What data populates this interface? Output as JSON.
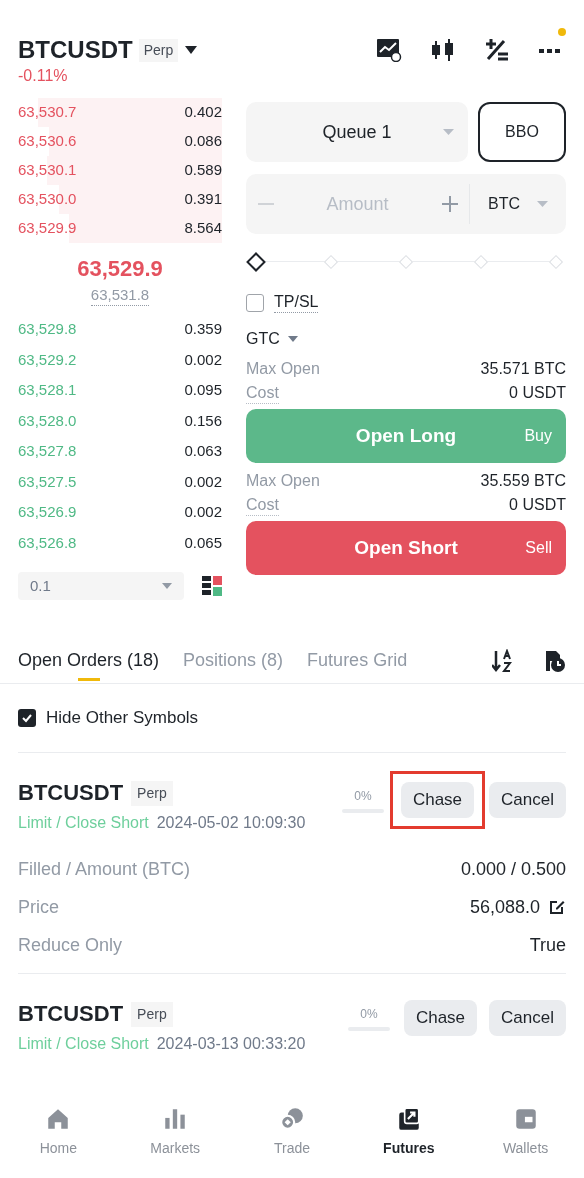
{
  "header": {
    "symbol": "BTCUSDT",
    "badge": "Perp",
    "change": "-0.11%"
  },
  "order_book": {
    "asks": [
      {
        "price": "63,530.7",
        "qty": "0.402"
      },
      {
        "price": "63,530.6",
        "qty": "0.086"
      },
      {
        "price": "63,530.1",
        "qty": "0.589"
      },
      {
        "price": "63,530.0",
        "qty": "0.391"
      },
      {
        "price": "63,529.9",
        "qty": "8.564"
      }
    ],
    "last_price": "63,529.9",
    "mark_price": "63,531.8",
    "bids": [
      {
        "price": "63,529.8",
        "qty": "0.359"
      },
      {
        "price": "63,529.2",
        "qty": "0.002"
      },
      {
        "price": "63,528.1",
        "qty": "0.095"
      },
      {
        "price": "63,528.0",
        "qty": "0.156"
      },
      {
        "price": "63,527.8",
        "qty": "0.063"
      },
      {
        "price": "63,527.5",
        "qty": "0.002"
      },
      {
        "price": "63,526.9",
        "qty": "0.002"
      },
      {
        "price": "63,526.8",
        "qty": "0.065"
      }
    ],
    "precision": "0.1"
  },
  "order_form": {
    "price_type": "Queue 1",
    "bbo": "BBO",
    "amount_placeholder": "Amount",
    "unit": "BTC",
    "slider": {
      "level": 0
    },
    "tpsl": {
      "label": "TP/SL",
      "checked": false
    },
    "tif": "GTC",
    "long": {
      "max_label": "Max Open",
      "max_value": "35.571 BTC",
      "cost_label": "Cost",
      "cost_value": "0 USDT",
      "button": "Open Long",
      "side": "Buy"
    },
    "short": {
      "max_label": "Max Open",
      "max_value": "35.559 BTC",
      "cost_label": "Cost",
      "cost_value": "0 USDT",
      "button": "Open Short",
      "side": "Sell"
    }
  },
  "tabs": [
    {
      "label": "Open Orders (18)",
      "selected": true
    },
    {
      "label": "Positions (8)",
      "selected": false
    },
    {
      "label": "Futures Grid",
      "selected": false
    }
  ],
  "hide_other": {
    "label": "Hide Other Symbols",
    "checked": true
  },
  "orders": [
    {
      "symbol": "BTCUSDT",
      "badge": "Perp",
      "type": "Limit / Close Short",
      "time": "2024-05-02 10:09:30",
      "progress": "0%",
      "level": 0,
      "chase": "Chase",
      "highlighted": true,
      "cancel": "Cancel",
      "details": [
        {
          "label": "Filled / Amount (BTC)",
          "value": "0.000 / 0.500",
          "editable": false
        },
        {
          "label": "Price",
          "value": "56,088.0",
          "editable": true
        },
        {
          "label": "Reduce Only",
          "value": "True",
          "editable": false
        }
      ]
    },
    {
      "symbol": "BTCUSDT",
      "badge": "Perp",
      "type": "Limit / Close Short",
      "time": "2024-03-13 00:33:20",
      "progress": "0%",
      "level": 0,
      "chase": "Chase",
      "highlighted": false,
      "cancel": "Cancel"
    }
  ],
  "nav": [
    {
      "label": "Home",
      "selected": false
    },
    {
      "label": "Markets",
      "selected": false
    },
    {
      "label": "Trade",
      "selected": false
    },
    {
      "label": "Futures",
      "selected": true
    },
    {
      "label": "Wallets",
      "selected": false
    }
  ]
}
